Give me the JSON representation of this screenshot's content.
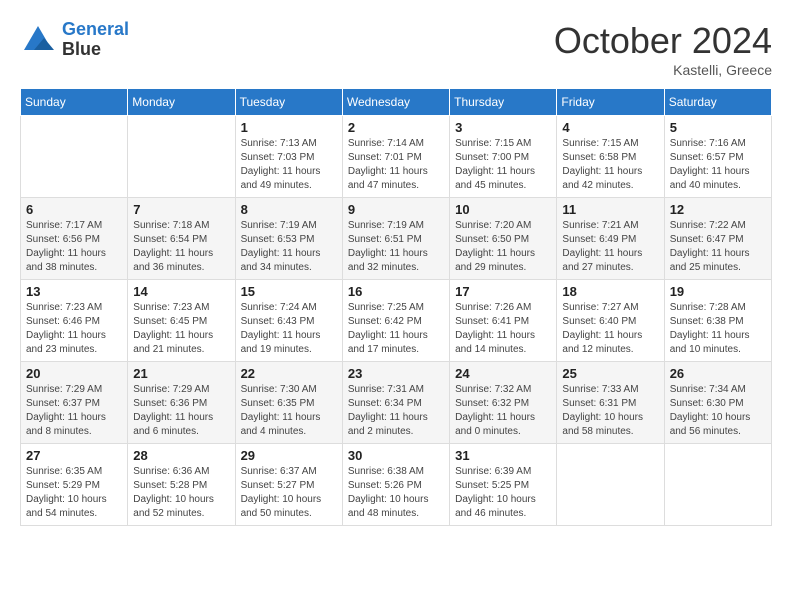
{
  "header": {
    "logo_line1": "General",
    "logo_line2": "Blue",
    "month_title": "October 2024",
    "location": "Kastelli, Greece"
  },
  "weekdays": [
    "Sunday",
    "Monday",
    "Tuesday",
    "Wednesday",
    "Thursday",
    "Friday",
    "Saturday"
  ],
  "weeks": [
    [
      {
        "day": "",
        "sunrise": "",
        "sunset": "",
        "daylight": ""
      },
      {
        "day": "",
        "sunrise": "",
        "sunset": "",
        "daylight": ""
      },
      {
        "day": "1",
        "sunrise": "Sunrise: 7:13 AM",
        "sunset": "Sunset: 7:03 PM",
        "daylight": "Daylight: 11 hours and 49 minutes."
      },
      {
        "day": "2",
        "sunrise": "Sunrise: 7:14 AM",
        "sunset": "Sunset: 7:01 PM",
        "daylight": "Daylight: 11 hours and 47 minutes."
      },
      {
        "day": "3",
        "sunrise": "Sunrise: 7:15 AM",
        "sunset": "Sunset: 7:00 PM",
        "daylight": "Daylight: 11 hours and 45 minutes."
      },
      {
        "day": "4",
        "sunrise": "Sunrise: 7:15 AM",
        "sunset": "Sunset: 6:58 PM",
        "daylight": "Daylight: 11 hours and 42 minutes."
      },
      {
        "day": "5",
        "sunrise": "Sunrise: 7:16 AM",
        "sunset": "Sunset: 6:57 PM",
        "daylight": "Daylight: 11 hours and 40 minutes."
      }
    ],
    [
      {
        "day": "6",
        "sunrise": "Sunrise: 7:17 AM",
        "sunset": "Sunset: 6:56 PM",
        "daylight": "Daylight: 11 hours and 38 minutes."
      },
      {
        "day": "7",
        "sunrise": "Sunrise: 7:18 AM",
        "sunset": "Sunset: 6:54 PM",
        "daylight": "Daylight: 11 hours and 36 minutes."
      },
      {
        "day": "8",
        "sunrise": "Sunrise: 7:19 AM",
        "sunset": "Sunset: 6:53 PM",
        "daylight": "Daylight: 11 hours and 34 minutes."
      },
      {
        "day": "9",
        "sunrise": "Sunrise: 7:19 AM",
        "sunset": "Sunset: 6:51 PM",
        "daylight": "Daylight: 11 hours and 32 minutes."
      },
      {
        "day": "10",
        "sunrise": "Sunrise: 7:20 AM",
        "sunset": "Sunset: 6:50 PM",
        "daylight": "Daylight: 11 hours and 29 minutes."
      },
      {
        "day": "11",
        "sunrise": "Sunrise: 7:21 AM",
        "sunset": "Sunset: 6:49 PM",
        "daylight": "Daylight: 11 hours and 27 minutes."
      },
      {
        "day": "12",
        "sunrise": "Sunrise: 7:22 AM",
        "sunset": "Sunset: 6:47 PM",
        "daylight": "Daylight: 11 hours and 25 minutes."
      }
    ],
    [
      {
        "day": "13",
        "sunrise": "Sunrise: 7:23 AM",
        "sunset": "Sunset: 6:46 PM",
        "daylight": "Daylight: 11 hours and 23 minutes."
      },
      {
        "day": "14",
        "sunrise": "Sunrise: 7:23 AM",
        "sunset": "Sunset: 6:45 PM",
        "daylight": "Daylight: 11 hours and 21 minutes."
      },
      {
        "day": "15",
        "sunrise": "Sunrise: 7:24 AM",
        "sunset": "Sunset: 6:43 PM",
        "daylight": "Daylight: 11 hours and 19 minutes."
      },
      {
        "day": "16",
        "sunrise": "Sunrise: 7:25 AM",
        "sunset": "Sunset: 6:42 PM",
        "daylight": "Daylight: 11 hours and 17 minutes."
      },
      {
        "day": "17",
        "sunrise": "Sunrise: 7:26 AM",
        "sunset": "Sunset: 6:41 PM",
        "daylight": "Daylight: 11 hours and 14 minutes."
      },
      {
        "day": "18",
        "sunrise": "Sunrise: 7:27 AM",
        "sunset": "Sunset: 6:40 PM",
        "daylight": "Daylight: 11 hours and 12 minutes."
      },
      {
        "day": "19",
        "sunrise": "Sunrise: 7:28 AM",
        "sunset": "Sunset: 6:38 PM",
        "daylight": "Daylight: 11 hours and 10 minutes."
      }
    ],
    [
      {
        "day": "20",
        "sunrise": "Sunrise: 7:29 AM",
        "sunset": "Sunset: 6:37 PM",
        "daylight": "Daylight: 11 hours and 8 minutes."
      },
      {
        "day": "21",
        "sunrise": "Sunrise: 7:29 AM",
        "sunset": "Sunset: 6:36 PM",
        "daylight": "Daylight: 11 hours and 6 minutes."
      },
      {
        "day": "22",
        "sunrise": "Sunrise: 7:30 AM",
        "sunset": "Sunset: 6:35 PM",
        "daylight": "Daylight: 11 hours and 4 minutes."
      },
      {
        "day": "23",
        "sunrise": "Sunrise: 7:31 AM",
        "sunset": "Sunset: 6:34 PM",
        "daylight": "Daylight: 11 hours and 2 minutes."
      },
      {
        "day": "24",
        "sunrise": "Sunrise: 7:32 AM",
        "sunset": "Sunset: 6:32 PM",
        "daylight": "Daylight: 11 hours and 0 minutes."
      },
      {
        "day": "25",
        "sunrise": "Sunrise: 7:33 AM",
        "sunset": "Sunset: 6:31 PM",
        "daylight": "Daylight: 10 hours and 58 minutes."
      },
      {
        "day": "26",
        "sunrise": "Sunrise: 7:34 AM",
        "sunset": "Sunset: 6:30 PM",
        "daylight": "Daylight: 10 hours and 56 minutes."
      }
    ],
    [
      {
        "day": "27",
        "sunrise": "Sunrise: 6:35 AM",
        "sunset": "Sunset: 5:29 PM",
        "daylight": "Daylight: 10 hours and 54 minutes."
      },
      {
        "day": "28",
        "sunrise": "Sunrise: 6:36 AM",
        "sunset": "Sunset: 5:28 PM",
        "daylight": "Daylight: 10 hours and 52 minutes."
      },
      {
        "day": "29",
        "sunrise": "Sunrise: 6:37 AM",
        "sunset": "Sunset: 5:27 PM",
        "daylight": "Daylight: 10 hours and 50 minutes."
      },
      {
        "day": "30",
        "sunrise": "Sunrise: 6:38 AM",
        "sunset": "Sunset: 5:26 PM",
        "daylight": "Daylight: 10 hours and 48 minutes."
      },
      {
        "day": "31",
        "sunrise": "Sunrise: 6:39 AM",
        "sunset": "Sunset: 5:25 PM",
        "daylight": "Daylight: 10 hours and 46 minutes."
      },
      {
        "day": "",
        "sunrise": "",
        "sunset": "",
        "daylight": ""
      },
      {
        "day": "",
        "sunrise": "",
        "sunset": "",
        "daylight": ""
      }
    ]
  ]
}
